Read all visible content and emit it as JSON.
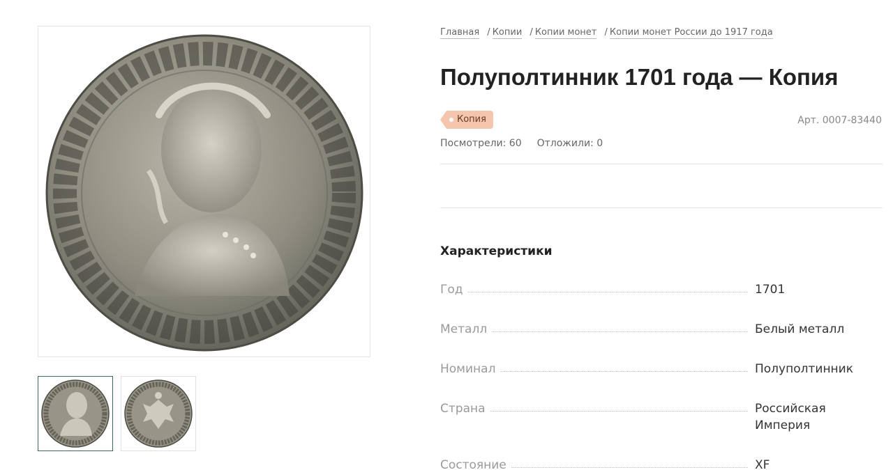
{
  "breadcrumb": {
    "items": [
      "Главная",
      "Копии",
      "Копии монет",
      "Копии монет России до 1917 года"
    ]
  },
  "product": {
    "title": "Полуполтинник 1701 года — Копия",
    "badge": "Копия",
    "sku": "Арт. 0007-83440",
    "views_label": "Посмотрели: 60",
    "saved_label": "Отложили: 0"
  },
  "specs": {
    "title": "Характеристики",
    "rows": [
      {
        "label": "Год",
        "value": "1701"
      },
      {
        "label": "Металл",
        "value": "Белый металл"
      },
      {
        "label": "Номинал",
        "value": "Полуполтинник"
      },
      {
        "label": "Страна",
        "value": "Российская Империя"
      },
      {
        "label": "Состояние",
        "value": "XF"
      }
    ]
  },
  "colors": {
    "badge_bg": "#f5c6ad",
    "active_thumb_border": "#3c6b5a"
  },
  "gallery": {
    "main_image": "coin-obverse-image",
    "thumbnails": [
      "coin-obverse-thumb",
      "coin-reverse-thumb"
    ]
  }
}
